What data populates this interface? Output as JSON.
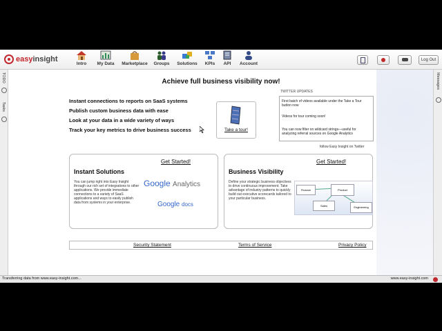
{
  "brand": {
    "name_part1": "easy",
    "name_part2": "insight"
  },
  "nav": [
    {
      "label": "Intro",
      "icon": "house-icon"
    },
    {
      "label": "My Data",
      "icon": "chart-icon"
    },
    {
      "label": "Marketplace",
      "icon": "bag-icon"
    },
    {
      "label": "Groups",
      "icon": "people-icon"
    },
    {
      "label": "Solutions",
      "icon": "puzzle-icon"
    },
    {
      "label": "KPIs",
      "icon": "kpi-icon"
    },
    {
      "label": "API",
      "icon": "book-icon"
    },
    {
      "label": "Account",
      "icon": "user-icon"
    }
  ],
  "toolbar": {
    "logout_label": "Log Out"
  },
  "left_rail": {
    "todo": "TODO",
    "tasks": "Tasks"
  },
  "right_rail": {
    "messages": "Messages"
  },
  "main": {
    "headline": "Achieve full business visibility now!",
    "bullets": [
      "Instant connections to reports on SaaS systems",
      "Publish custom business data with ease",
      "Look at your data in a wide variety of ways",
      "Track your key metrics to drive business success"
    ],
    "tour_link": "Take a tour!",
    "twitter": {
      "label": "TWITTER UPDATES",
      "items": [
        "First batch of videos available under the Take a Tour button now",
        "Videos for tour coming soon!",
        "You can now filter on wildcard strings—useful for analyzing referral sources on Google Analytics"
      ],
      "follow": "follow Easy Insight on Twitter"
    },
    "cards": [
      {
        "title": "Instant Solutions",
        "cta": "Get Started!",
        "desc": "You can jump right into Easy Insight through our rich set of integrations to other applications. We provide immediate connections to a variety of SaaS applications and ways to easily publish data from systems in your enterprise.",
        "logos": [
          "Google",
          "Analytics",
          "Google",
          "docs"
        ]
      },
      {
        "title": "Business Visibility",
        "cta": "Get Started!",
        "desc": "Define your strategic business objectives to drive continuous improvement. Take advantage of industry patterns to quickly build out executive scorecards tailored to your particular business.",
        "diagram_labels": [
          "Finance",
          "Product",
          "Sales",
          "Engineering"
        ]
      }
    ],
    "footer_links": [
      "Security Statement",
      "Terms of Service",
      "Privacy Policy"
    ]
  },
  "status": {
    "left": "Transferring data from www.easy-insight.com...",
    "right": "www.easy-insight.com"
  },
  "colors": {
    "brand_red": "#c2262d",
    "google_blue": "#3366cc"
  }
}
